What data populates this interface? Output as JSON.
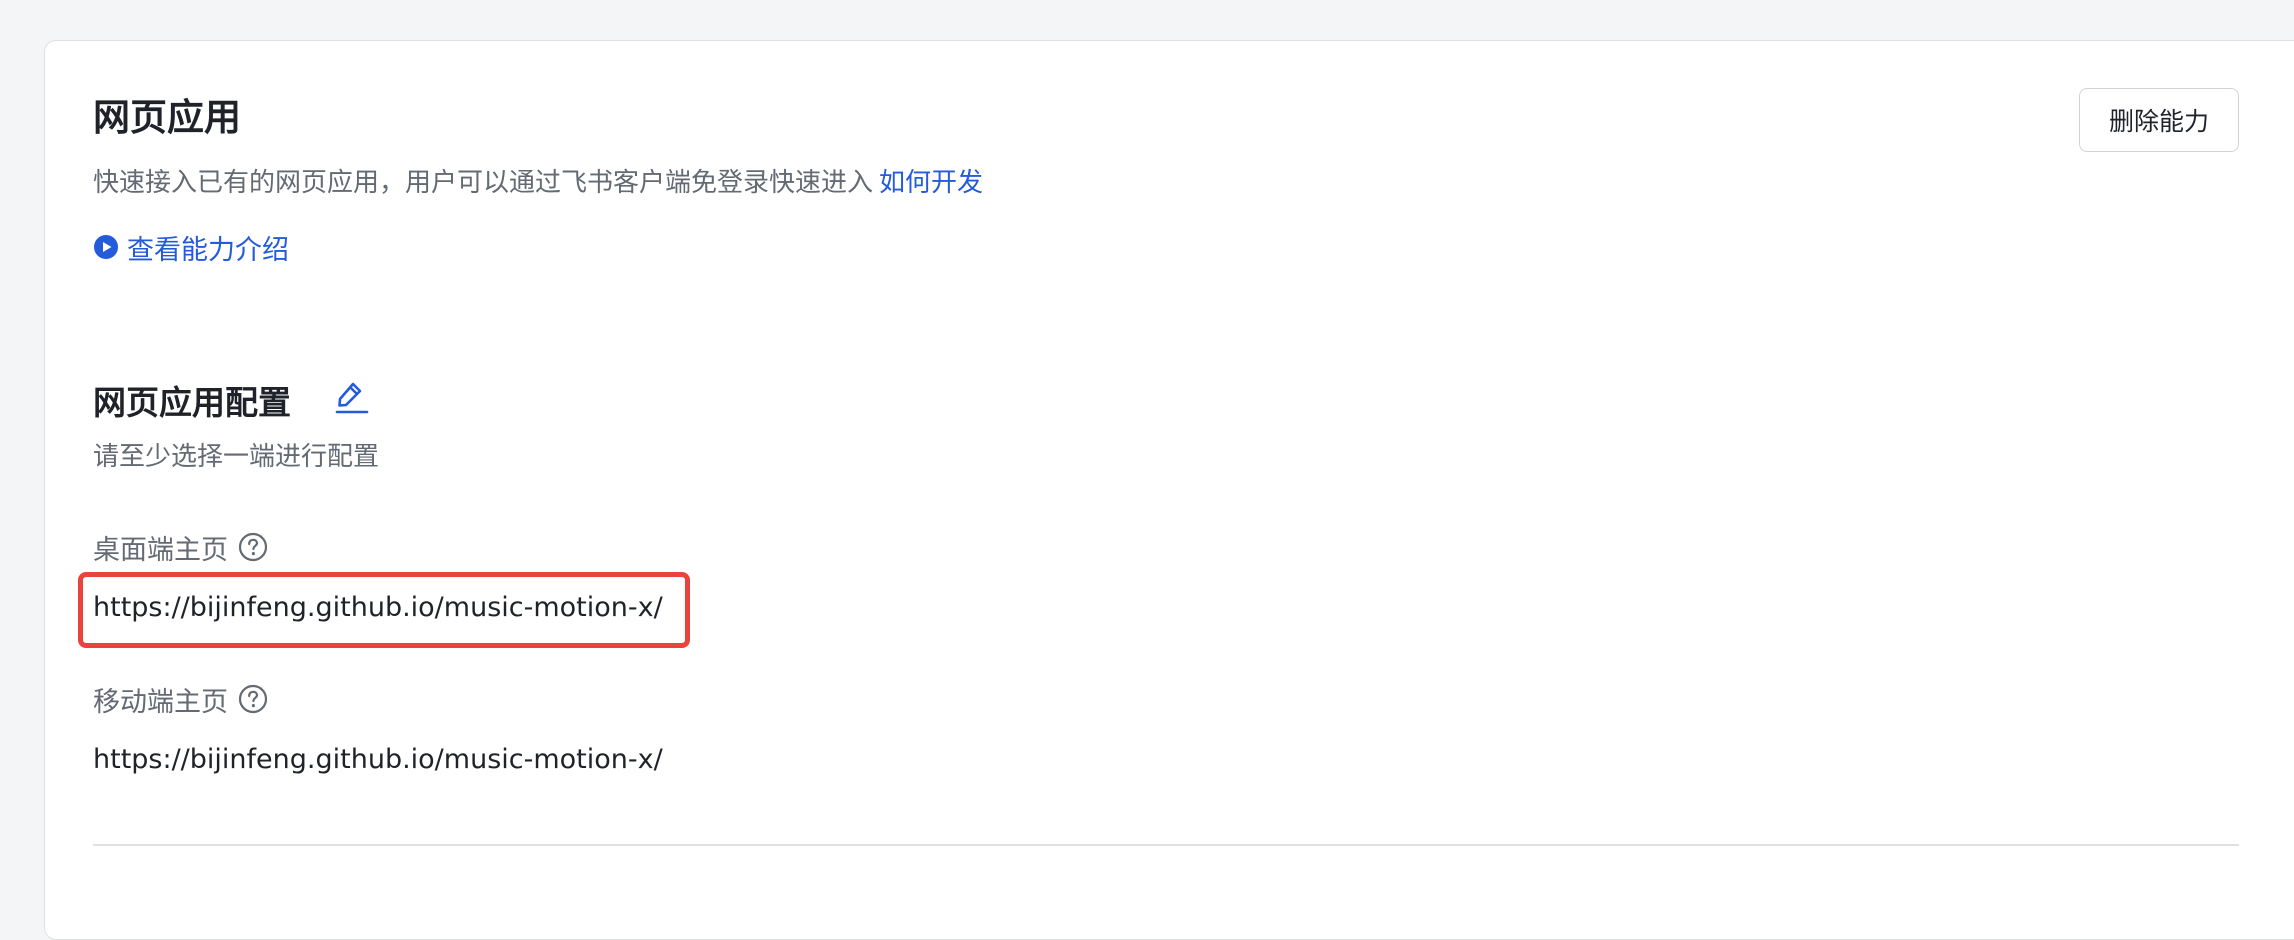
{
  "header": {
    "title": "网页应用",
    "description": "快速接入已有的网页应用，用户可以通过飞书客户端免登录快速进入",
    "how_to_link": "如何开发",
    "intro_link": "查看能力介绍",
    "delete_label": "删除能力"
  },
  "config": {
    "title": "网页应用配置",
    "description": "请至少选择一端进行配置",
    "desktop": {
      "label": "桌面端主页",
      "value": "https://bijinfeng.github.io/music-motion-x/"
    },
    "mobile": {
      "label": "移动端主页",
      "value": "https://bijinfeng.github.io/music-motion-x/"
    }
  },
  "icons": {
    "play": "play-circle-icon",
    "edit": "edit-pencil-icon",
    "help": "question-circle-icon"
  },
  "colors": {
    "accent": "#245bdb",
    "highlight": "#e8433d",
    "text_primary": "#1f2329",
    "text_secondary": "#646a73"
  }
}
